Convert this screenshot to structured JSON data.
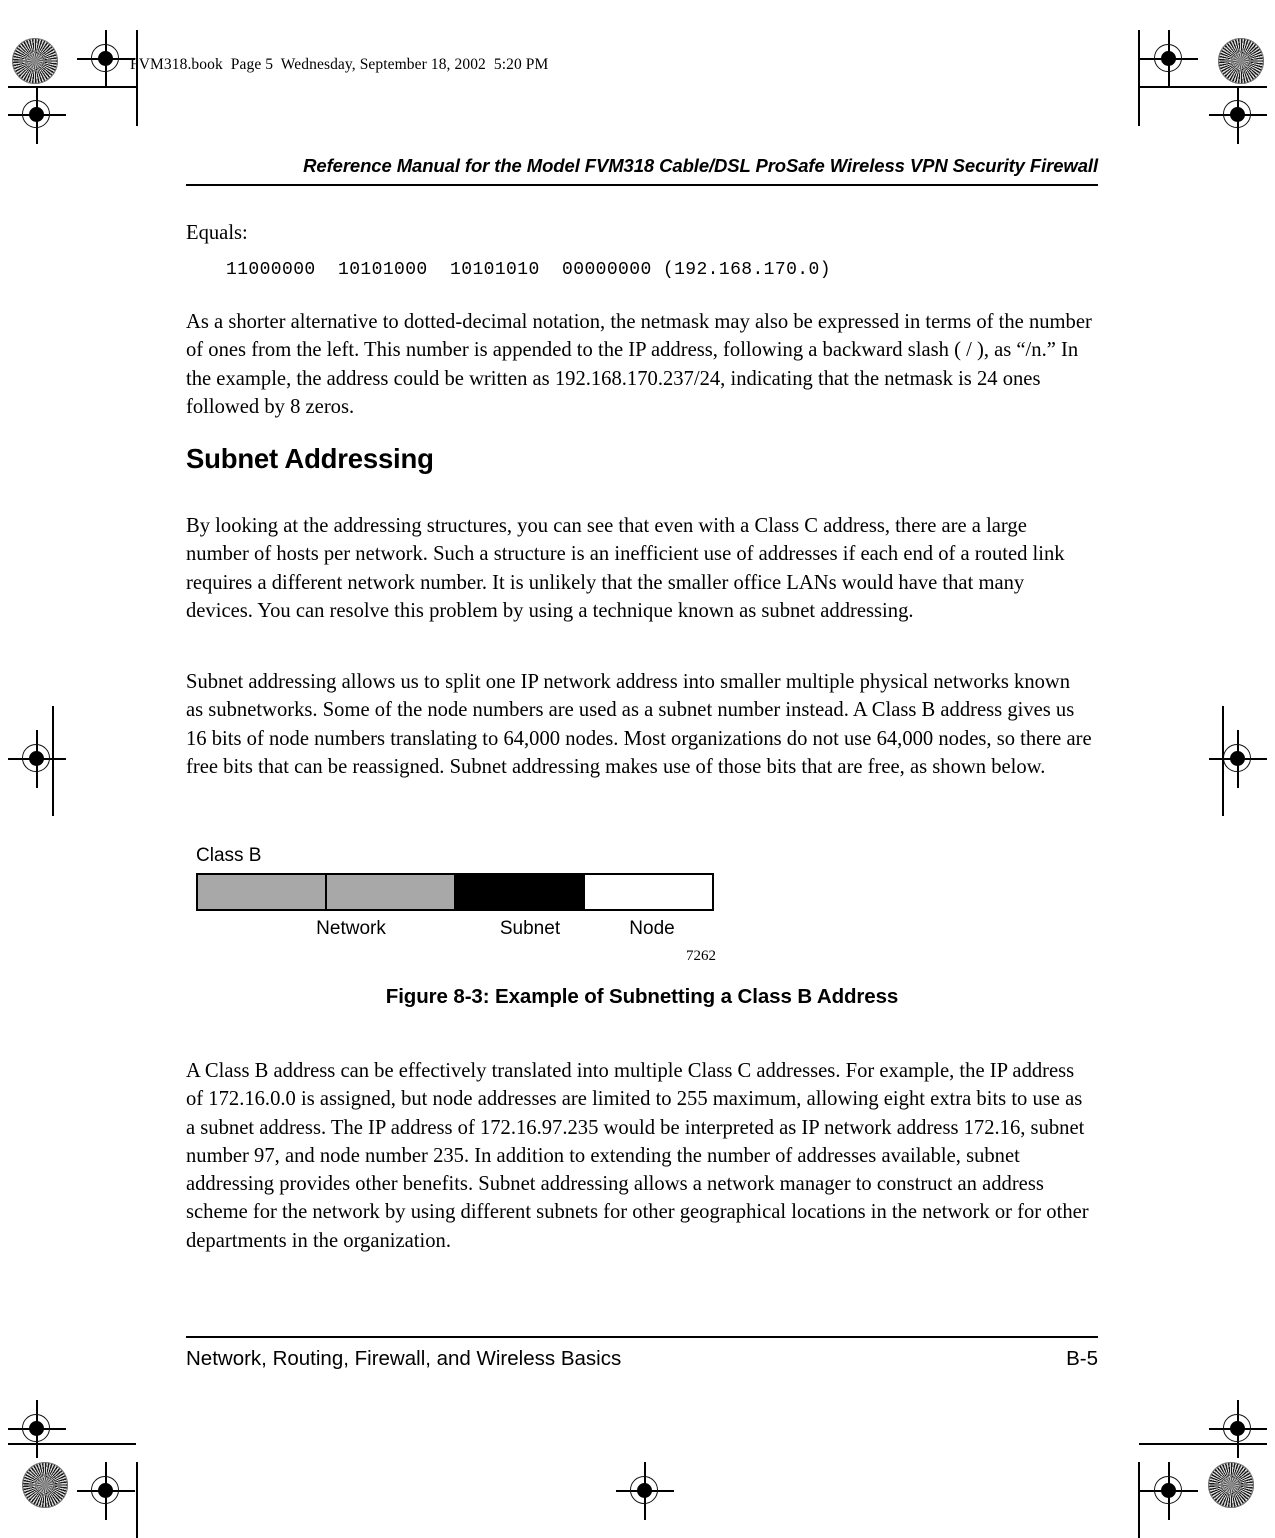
{
  "file_banner": "FVM318.book  Page 5  Wednesday, September 18, 2002  5:20 PM",
  "header": {
    "running_title": "Reference Manual for the Model FVM318 Cable/DSL ProSafe Wireless VPN Security Firewall"
  },
  "body": {
    "equals_label": "Equals:",
    "code_line": "11000000  10101000  10101010  00000000 (192.168.170.0)",
    "para_netmask": "As a shorter alternative to dotted-decimal notation, the netmask may also be expressed in terms of the number of ones from the left. This number is appended to the IP address, following a backward slash ( / ), as “/n.” In the example, the address could be written as 192.168.170.237/24, indicating that the netmask is 24 ones followed by 8 zeros.",
    "section_heading": "Subnet Addressing",
    "para_classc": "By looking at the addressing structures, you can see that even with a Class C address, there are a large number of hosts per network. Such a structure is an inefficient use of addresses if each end of a routed link requires a different network number. It is unlikely that the smaller office LANs would have that many devices. You can resolve this problem by using a technique known as subnet addressing.",
    "para_split": "Subnet addressing allows us to split one IP network address into smaller multiple physical networks known as subnetworks. Some of the node numbers are used as a subnet number instead. A Class B address gives us 16 bits of node numbers translating to 64,000 nodes. Most organizations do not use 64,000 nodes, so there are free bits that can be reassigned. Subnet addressing makes use of those bits that are free, as shown below.",
    "para_final": "A Class B address can be effectively translated into multiple Class C addresses. For example, the IP address of 172.16.0.0 is assigned, but node addresses are limited to 255 maximum, allowing eight extra bits to use as a subnet address. The IP address of 172.16.97.235 would be interpreted as IP network address 172.16, subnet number 97, and node number 235. In addition to extending the number of addresses available, subnet addressing provides other benefits. Subnet addressing allows a network manager to construct an address scheme for the network by using different subnets for other geographical locations in the network or for other departments in the organization."
  },
  "figure": {
    "class_label": "Class B",
    "segments": [
      {
        "name": "network-byte-1",
        "fill": "#a8a8a8"
      },
      {
        "name": "network-byte-2",
        "fill": "#a8a8a8"
      },
      {
        "name": "subnet-byte",
        "fill": "#000000"
      },
      {
        "name": "node-byte",
        "fill": "#ffffff"
      }
    ],
    "segment_labels": {
      "network": "Network",
      "subnet": "Subnet",
      "node": "Node"
    },
    "figure_number": "7262",
    "caption": "Figure 8-3: Example of Subnetting a Class B Address"
  },
  "footer": {
    "section_title": "Network, Routing, Firewall, and Wireless Basics",
    "page_number": "B-5"
  }
}
